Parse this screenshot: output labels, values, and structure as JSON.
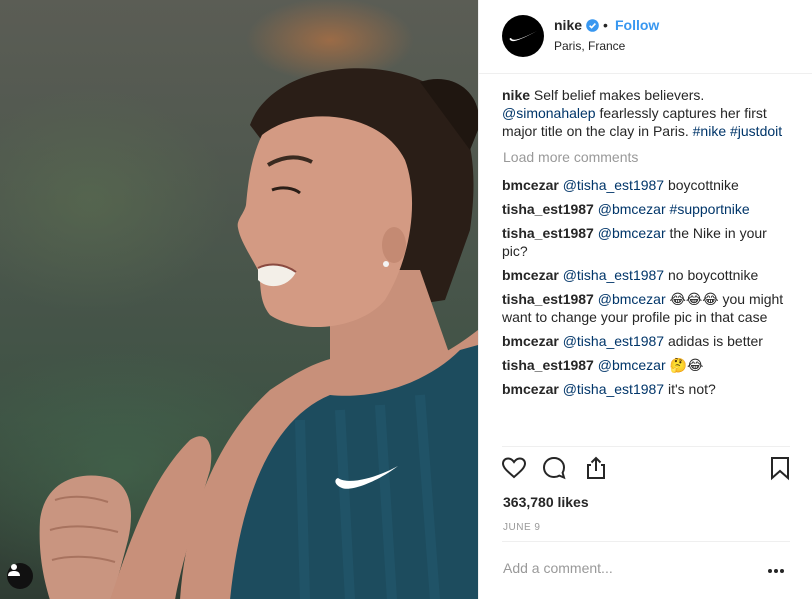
{
  "post": {
    "username": "nike",
    "follow_label": "Follow",
    "location": "Paris, France",
    "caption": {
      "username": "nike",
      "text1": "Self belief makes believers.",
      "mention": "@simonahalep",
      "text2": "fearlessly captures her first major title on the clay in Paris.",
      "tag1": "#nike",
      "tag2": "#justdoit"
    },
    "load_more": "Load more comments",
    "comments": [
      {
        "user": "bmcezar",
        "mention": "@tisha_est1987",
        "text": "boycottnike"
      },
      {
        "user": "tisha_est1987",
        "mention": "@bmcezar",
        "text": "#supportnike"
      },
      {
        "user": "tisha_est1987",
        "mention": "@bmcezar",
        "text": "the Nike in your pic?"
      },
      {
        "user": "bmcezar",
        "mention": "@tisha_est1987",
        "text": "no boycottnike"
      },
      {
        "user": "tisha_est1987",
        "mention": "@bmcezar",
        "text": "😂😂😂 you might want to change your profile pic in that case"
      },
      {
        "user": "bmcezar",
        "mention": "@tisha_est1987",
        "text": "adidas is better"
      },
      {
        "user": "tisha_est1987",
        "mention": "@bmcezar",
        "text": "🤔😂"
      },
      {
        "user": "bmcezar",
        "mention": "@tisha_est1987",
        "text": "it's not?"
      }
    ],
    "likes": "363,780 likes",
    "date": "JUNE 9",
    "add_comment_placeholder": "Add a comment..."
  },
  "icons": {
    "avatar": "nike-swoosh-icon",
    "verified": "verified-badge-icon",
    "like": "heart-icon",
    "comment": "comment-bubble-icon",
    "share": "share-icon",
    "save": "bookmark-icon",
    "more": "more-dots-icon",
    "user_tag": "user-tag-icon"
  },
  "colors": {
    "link_blue": "#3897f0",
    "mention_blue": "#003569",
    "muted_gray": "#999999",
    "text": "#262626"
  }
}
